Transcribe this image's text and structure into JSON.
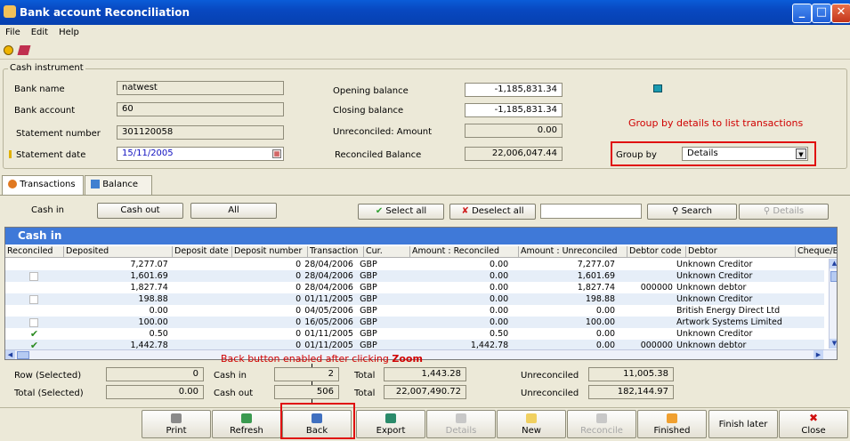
{
  "window": {
    "title": "Bank account Reconciliation"
  },
  "menu": [
    "File",
    "Edit",
    "Help"
  ],
  "toolbar_icons": [
    "euro-icon",
    "book-icon"
  ],
  "cash_instrument": {
    "legend": "Cash instrument",
    "bank_name_label": "Bank name",
    "bank_name": "natwest",
    "bank_account_label": "Bank account",
    "bank_account": "60",
    "statement_number_label": "Statement number",
    "statement_number": "301120058",
    "statement_date_label": "Statement date",
    "statement_date": "15/11/2005",
    "opening_balance_label": "Opening balance",
    "opening_balance": "-1,185,831.34",
    "closing_balance_label": "Closing balance",
    "closing_balance": "-1,185,831.34",
    "unreconciled_amount_label": "Unreconciled: Amount",
    "unreconciled_amount": "0.00",
    "reconciled_balance_label": "Reconciled Balance",
    "reconciled_balance": "22,006,047.44",
    "group_by_label": "Group by",
    "group_by_value": "Details",
    "group_by_annotation": "Group by details to list transactions"
  },
  "tabs": [
    "Transactions",
    "Balance"
  ],
  "filter_buttons": {
    "cash_in": "Cash in",
    "cash_out": "Cash out",
    "all": "All"
  },
  "action_buttons": {
    "select_all": "Select all",
    "deselect_all": "Deselect all",
    "search": "Search",
    "details": "Details"
  },
  "grid": {
    "banner": "Cash in",
    "columns": [
      "Reconciled",
      "Deposited",
      "Deposit date",
      "Deposit number",
      "Transaction",
      "Cur.",
      "Amount : Reconciled",
      "Amount : Unreconciled",
      "Debtor code",
      "Debtor",
      "Cheque/B"
    ],
    "rows": [
      {
        "reconciled": "",
        "deposited": "7,277.07",
        "deposit_date": "",
        "deposit_number": "0",
        "transaction": "28/04/2006",
        "cur": "GBP",
        "amt_rec": "0.00",
        "amt_unrec": "7,277.07",
        "debtor_code": "",
        "debtor": "Unknown Creditor"
      },
      {
        "reconciled": "box",
        "deposited": "1,601.69",
        "deposit_date": "",
        "deposit_number": "0",
        "transaction": "28/04/2006",
        "cur": "GBP",
        "amt_rec": "0.00",
        "amt_unrec": "1,601.69",
        "debtor_code": "",
        "debtor": "Unknown Creditor"
      },
      {
        "reconciled": "",
        "deposited": "1,827.74",
        "deposit_date": "",
        "deposit_number": "0",
        "transaction": "28/04/2006",
        "cur": "GBP",
        "amt_rec": "0.00",
        "amt_unrec": "1,827.74",
        "debtor_code": "000000",
        "debtor": "Unknown debtor"
      },
      {
        "reconciled": "box",
        "deposited": "198.88",
        "deposit_date": "",
        "deposit_number": "0",
        "transaction": "01/11/2005",
        "cur": "GBP",
        "amt_rec": "0.00",
        "amt_unrec": "198.88",
        "debtor_code": "",
        "debtor": "Unknown Creditor"
      },
      {
        "reconciled": "",
        "deposited": "0.00",
        "deposit_date": "",
        "deposit_number": "0",
        "transaction": "04/05/2006",
        "cur": "GBP",
        "amt_rec": "0.00",
        "amt_unrec": "0.00",
        "debtor_code": "",
        "debtor": "British Energy Direct Ltd"
      },
      {
        "reconciled": "box",
        "deposited": "100.00",
        "deposit_date": "",
        "deposit_number": "0",
        "transaction": "16/05/2006",
        "cur": "GBP",
        "amt_rec": "0.00",
        "amt_unrec": "100.00",
        "debtor_code": "",
        "debtor": "Artwork Systems Limited"
      },
      {
        "reconciled": "check",
        "deposited": "0.50",
        "deposit_date": "",
        "deposit_number": "0",
        "transaction": "01/11/2005",
        "cur": "GBP",
        "amt_rec": "0.50",
        "amt_unrec": "0.00",
        "debtor_code": "",
        "debtor": "Unknown Creditor"
      },
      {
        "reconciled": "check",
        "deposited": "1,442.78",
        "deposit_date": "",
        "deposit_number": "0",
        "transaction": "01/11/2005",
        "cur": "GBP",
        "amt_rec": "1,442.78",
        "amt_unrec": "0.00",
        "debtor_code": "000000",
        "debtor": "Unknown debtor"
      }
    ]
  },
  "annotation_back": {
    "prefix": "Back button enabled after clicking",
    "bold": "Zoom"
  },
  "totals": {
    "row_selected_label": "Row (Selected)",
    "row_selected": "0",
    "total_selected_label": "Total (Selected)",
    "total_selected": "0.00",
    "cash_in_label": "Cash in",
    "cash_in_count": "2",
    "cash_out_label": "Cash out",
    "cash_out_count": "506",
    "total_label": "Total",
    "total_in": "1,443.28",
    "total_out": "22,007,490.72",
    "unreconciled_label": "Unreconciled",
    "unreconciled_in": "11,005.38",
    "unreconciled_out": "182,144.97"
  },
  "bottom_buttons": {
    "print": "Print",
    "refresh": "Refresh",
    "back": "Back",
    "export": "Export",
    "details": "Details",
    "new": "New",
    "reconcile": "Reconcile",
    "finished": "Finished",
    "finish_later": "Finish later",
    "close": "Close"
  }
}
